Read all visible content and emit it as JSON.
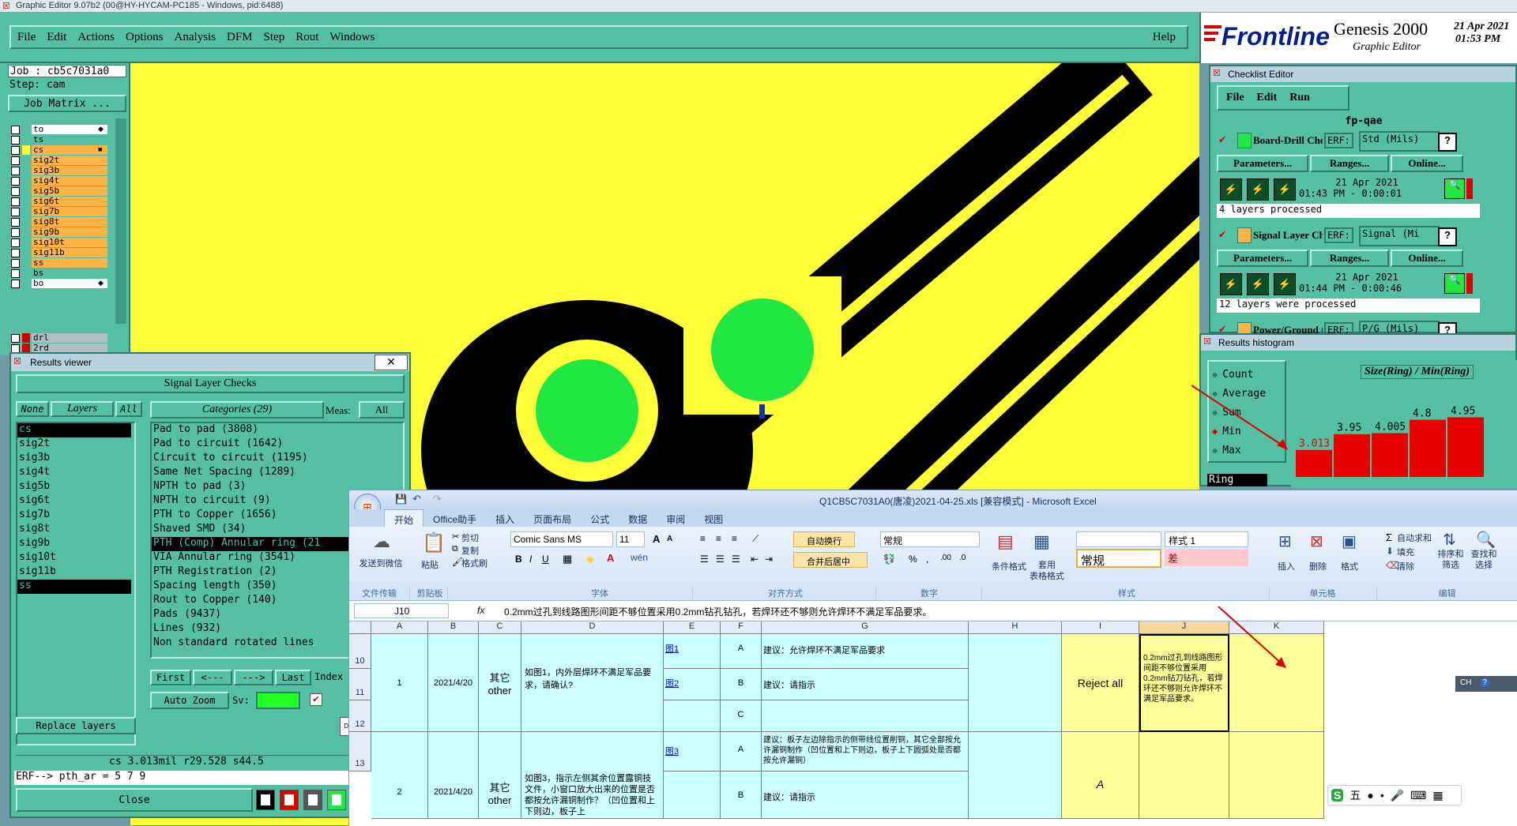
{
  "ge": {
    "title": "Graphic Editor 9.07b2 (00@HY-HYCAM-PC185 - Windows, pid:6488)",
    "menu": [
      "File",
      "Edit",
      "Actions",
      "Options",
      "Analysis",
      "DFM",
      "Step",
      "Rout",
      "Windows"
    ],
    "help": "Help",
    "brand": "Frontline",
    "product": "Genesis 2000",
    "subtitle": "Graphic Editor",
    "date": "21 Apr 2021",
    "time": "01:53 PM",
    "job": "Job : cb5c7031a0",
    "step": "Step: cam",
    "job_matrix": "Job Matrix ...",
    "layers": [
      {
        "name": "to",
        "color": "#ffffff",
        "flag": "◆"
      },
      {
        "name": "ts",
        "color": "#54bfa3",
        "flag": ""
      },
      {
        "name": "cs",
        "color": "#ffb347",
        "flag": "■"
      },
      {
        "name": "sig2t",
        "color": "#ffb347",
        "flag": ""
      },
      {
        "name": "sig3b",
        "color": "#ffb347",
        "flag": ""
      },
      {
        "name": "sig4t",
        "color": "#ffb347",
        "flag": ""
      },
      {
        "name": "sig5b",
        "color": "#ffb347",
        "flag": ""
      },
      {
        "name": "sig6t",
        "color": "#ffb347",
        "flag": ""
      },
      {
        "name": "sig7b",
        "color": "#ffb347",
        "flag": ""
      },
      {
        "name": "sig8t",
        "color": "#ffb347",
        "flag": ""
      },
      {
        "name": "sig9b",
        "color": "#ffb347",
        "flag": ""
      },
      {
        "name": "sig10t",
        "color": "#ffb347",
        "flag": ""
      },
      {
        "name": "sig11b",
        "color": "#ffb347",
        "flag": ""
      },
      {
        "name": "ss",
        "color": "#ffb347",
        "flag": ""
      },
      {
        "name": "bs",
        "color": "#54bfa3",
        "flag": ""
      },
      {
        "name": "bo",
        "color": "#ffffff",
        "flag": "◆"
      }
    ],
    "drill_layers": [
      "drl",
      "2rd"
    ]
  },
  "results": {
    "title": "Results viewer",
    "header": "Signal Layer Checks",
    "none": "None",
    "layers_label": "Layers",
    "all": "All",
    "categories": "Categories (29)",
    "meas": "Meas:",
    "meas_val": "All",
    "layer_list": [
      "cs",
      "sig2t",
      "sig3b",
      "sig4t",
      "sig5b",
      "sig6t",
      "sig7b",
      "sig8t",
      "sig9b",
      "sig10t",
      "sig11b",
      "ss"
    ],
    "cat_list": [
      "Pad to pad (3808)",
      "Pad to circuit (1642)",
      "Circuit to circuit (1195)",
      "Same Net Spacing (1289)",
      "NPTH to pad (3)",
      "NPTH to circuit (9)",
      "PTH to Copper (1656)",
      "Shaved SMD (34)",
      "PTH (Comp) Annular ring (21",
      "VIA Annular ring (3541)",
      "PTH Registration (2)",
      "Spacing length (350)",
      "Rout to Copper (140)",
      "Pads (9437)",
      "Lines (932)",
      "Non standard rotated lines"
    ],
    "first": "First",
    "prev": "<---",
    "next": "--->",
    "last": "Last",
    "index": "Index",
    "auto_zoom": "Auto Zoom",
    "sv": "Sv:",
    "replace_layers": "Replace layers",
    "status": "cs 3.013mil  r29.528  s44.5",
    "erf": "ERF--> pth_ar = 5 7 9",
    "close": "Close"
  },
  "checklist": {
    "title": "Checklist Editor",
    "menu": [
      "File",
      "Edit",
      "Run"
    ],
    "name": "fp-qae",
    "items": [
      {
        "name": "Board-Drill Che",
        "erf": "ERF:",
        "erf_val": "Std (Mils)",
        "date": "21 Apr 2021",
        "time": "01:43 PM - 0:00:01",
        "msg": "4 layers processed"
      },
      {
        "name": "Signal Layer Ch",
        "erf": "ERF:",
        "erf_val": "Signal (Mi",
        "date": "21 Apr 2021",
        "time": "01:44 PM - 0:00:46",
        "msg": "12 layers were processed"
      },
      {
        "name": "Power/Ground C",
        "erf": "ERF:",
        "erf_val": "P/G (Mils)",
        "date": "",
        "time": "",
        "msg": ""
      }
    ],
    "parameters": "Parameters...",
    "ranges": "Ranges...",
    "online": "Online..."
  },
  "histogram": {
    "title": "Results histogram",
    "options": [
      "Count",
      "Average",
      "Sum",
      "Min",
      "Max"
    ],
    "selected": "Min",
    "field": "Ring",
    "chart_title": "Size(Ring) / Min(Ring)",
    "bars": [
      {
        "label": "3.013",
        "value": 3.013
      },
      {
        "label": "3.95",
        "value": 3.95
      },
      {
        "label": "4.005",
        "value": 4.005
      },
      {
        "label": "4.8",
        "value": 4.8
      },
      {
        "label": "4.95",
        "value": 4.95
      }
    ]
  },
  "excel": {
    "title": "Q1CB5C7031A0(唐凌)2021-04-25.xls  [兼容模式] - Microsoft Excel",
    "tabs": [
      "开始",
      "Office助手",
      "插入",
      "页面布局",
      "公式",
      "数据",
      "审阅",
      "视图"
    ],
    "send_wechat": "发送到微信",
    "paste": "粘贴",
    "cut": "剪切",
    "copy": "复制",
    "format_painter": "格式刷",
    "font": "Comic Sans MS",
    "font_size": "11",
    "wrap": "自动换行",
    "merge": "合并后居中",
    "number_format": "常规",
    "cond_format": "条件格式",
    "table_format": "套用\n表格格式",
    "style_normal": "常规",
    "style_1": "样式 1",
    "style_bad": "差",
    "insert": "插入",
    "delete": "删除",
    "format": "格式",
    "autosum": "自动求和",
    "fill": "填充",
    "clear": "清除",
    "sort": "排序和\n筛选",
    "find": "查找和\n选择",
    "groups": [
      "文件传输",
      "剪贴板",
      "字体",
      "对齐方式",
      "数字",
      "样式",
      "单元格",
      "编辑"
    ],
    "name_box": "J10",
    "formula": "0.2mm过孔到线路图形间距不够位置采用0.2mm钻孔钻孔，若焊环还不够则允许焊环不满足军品要求。",
    "columns": [
      "A",
      "B",
      "C",
      "D",
      "E",
      "F",
      "G",
      "H",
      "I",
      "J",
      "K"
    ],
    "row_nums": [
      "10",
      "11",
      "12",
      "13"
    ],
    "r1_no": "1",
    "r1_date": "2021/4/20",
    "r1_type": "其它\nother",
    "r1_desc": "如图1，内外层焊环不满足军品要求，请确认?",
    "r1_links": [
      "图1",
      "图2"
    ],
    "r1_opts": [
      "A",
      "B",
      "C"
    ],
    "r1_sugg": [
      "建议：允许焊环不满足军品要求",
      "建议：请指示"
    ],
    "r1_reply": "Reject all",
    "j10": "0.2mm过孔到线路图形间距不够位置采用0.2mm钻刀钻孔，若焊环还不够则允许焊环不满足军品要求。",
    "r2_no": "2",
    "r2_date": "2021/4/20",
    "r2_type": "其它\nother",
    "r2_desc": "如图3，指示左侧其余位置露铜技文件，小窗口放大出来的位置是否都按允许漏铜制作？（凹位置和上下则边，板子上",
    "r2_link": "图3",
    "r2_opts": [
      "A",
      "B"
    ],
    "r2_sugg": [
      "建议：板子左边除指示的侧带线位置削铜，其它全部按允许漏铜制作（凹位置和上下则边，板子上下圆弧处是否都按允许漏铜）",
      "建议：请指示"
    ],
    "r2_reply": "A"
  },
  "ime": {
    "label": "五"
  },
  "ch": "CH"
}
